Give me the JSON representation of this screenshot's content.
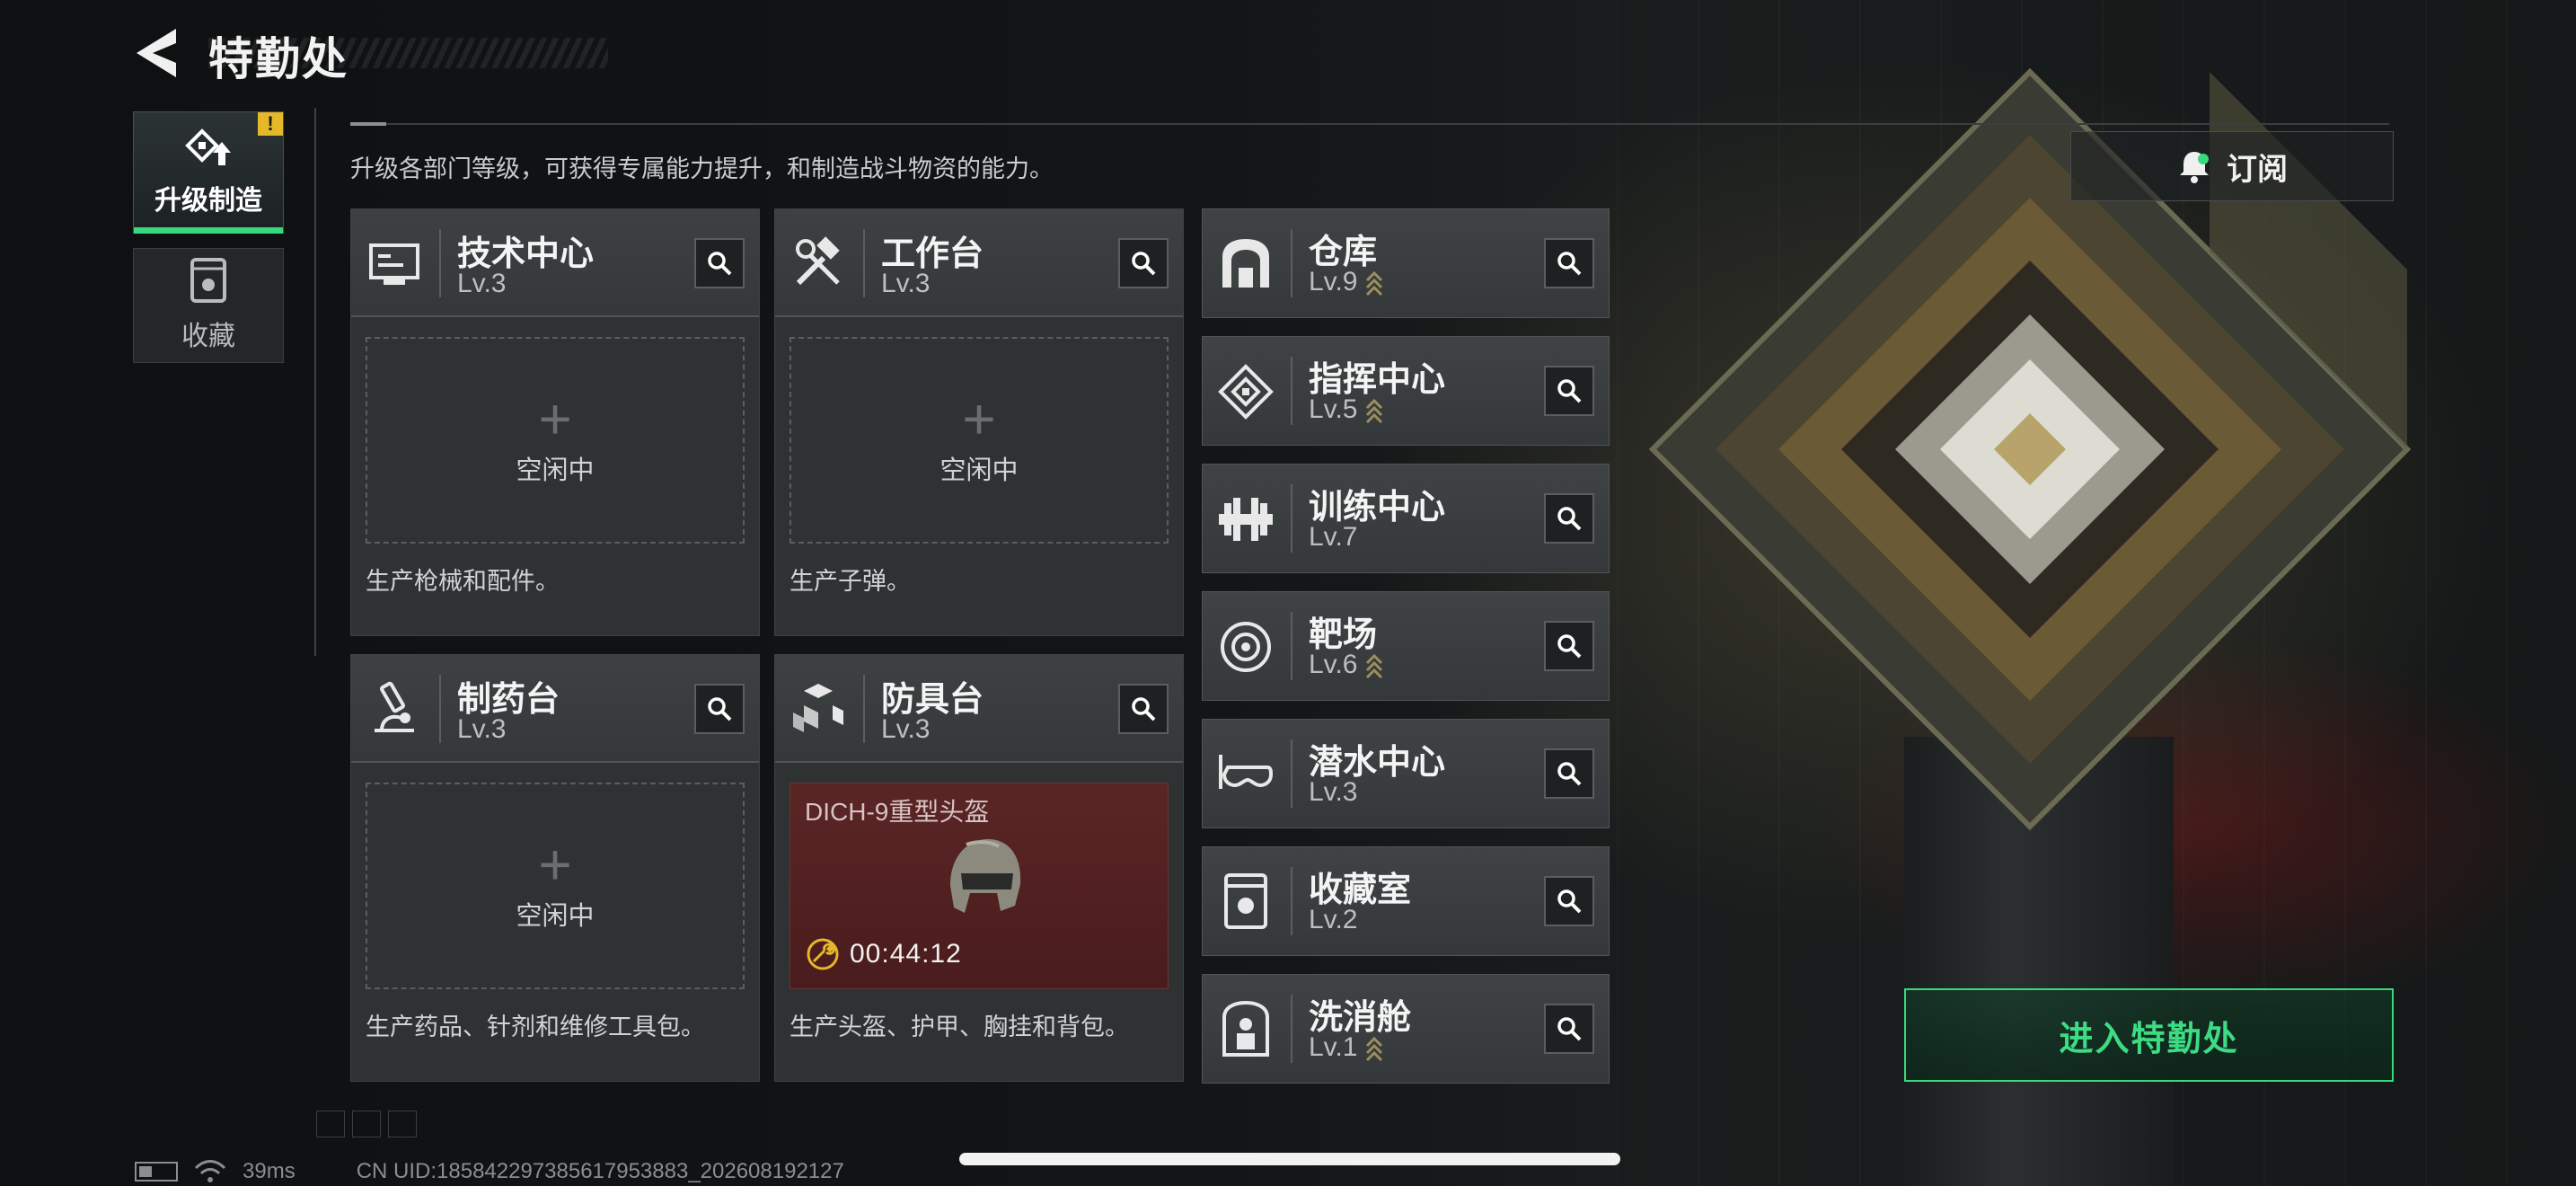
{
  "header": {
    "title": "特勤处",
    "back_icon": "back-arrow-icon"
  },
  "sidebar": {
    "tabs": [
      {
        "label": "升级制造",
        "icon": "upgrade-icon",
        "active": true,
        "badge": "!"
      },
      {
        "label": "收藏",
        "icon": "collection-icon",
        "active": false
      }
    ]
  },
  "main": {
    "subtitle": "升级各部门等级，可获得专属能力提升，和制造战斗物资的能力。",
    "subscribe_label": "订阅",
    "enter_label": "进入特勤处",
    "idle_label": "空闲中",
    "workshops": [
      {
        "name": "技术中心",
        "level": "Lv.3",
        "icon": "tech-center-icon",
        "desc": "生产枪械和配件。"
      },
      {
        "name": "工作台",
        "level": "Lv.3",
        "icon": "workbench-icon",
        "desc": "生产子弹。"
      },
      {
        "name": "制药台",
        "level": "Lv.3",
        "icon": "pharmacy-icon",
        "desc": "生产药品、针剂和维修工具包。"
      },
      {
        "name": "防具台",
        "level": "Lv.3",
        "icon": "armor-bench-icon",
        "desc": "生产头盔、护甲、胸挂和背包。",
        "production": {
          "item": "DICH-9重型头盔",
          "timer": "00:44:12"
        }
      }
    ],
    "facilities": [
      {
        "name": "仓库",
        "level": "Lv.9",
        "icon": "warehouse-icon",
        "upgradable": true
      },
      {
        "name": "指挥中心",
        "level": "Lv.5",
        "icon": "command-center-icon",
        "upgradable": true
      },
      {
        "name": "训练中心",
        "level": "Lv.7",
        "icon": "training-center-icon",
        "upgradable": false
      },
      {
        "name": "靶场",
        "level": "Lv.6",
        "icon": "shooting-range-icon",
        "upgradable": true
      },
      {
        "name": "潜水中心",
        "level": "Lv.3",
        "icon": "diving-center-icon",
        "upgradable": false
      },
      {
        "name": "收藏室",
        "level": "Lv.2",
        "icon": "collection-room-icon",
        "upgradable": false
      },
      {
        "name": "洗消舱",
        "level": "Lv.1",
        "icon": "decon-chamber-icon",
        "upgradable": true
      }
    ]
  },
  "status_bar": {
    "ping": "39ms",
    "uid": "CN UID:185842297385617953883_202608192127"
  },
  "colors": {
    "accent": "#37d97f",
    "warning": "#e5b829",
    "production_bg": "#5a2525"
  }
}
